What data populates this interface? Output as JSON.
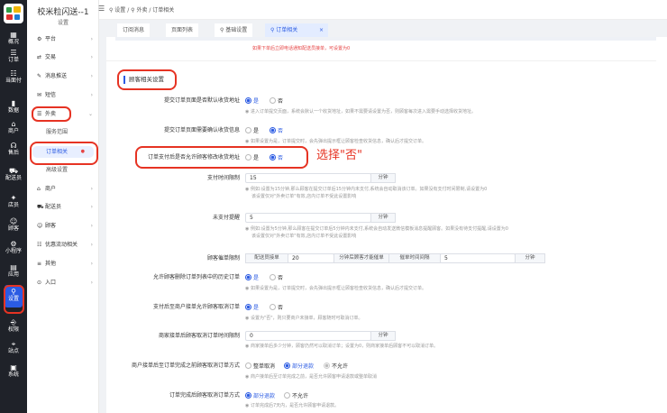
{
  "rail": {
    "items": [
      {
        "icon": "▦",
        "label": "概况"
      },
      {
        "icon": "☰",
        "label": "订单"
      },
      {
        "icon": "☷",
        "label": "当面付"
      },
      {
        "icon": "▮",
        "label": "数据"
      },
      {
        "icon": "⌂",
        "label": "商户"
      },
      {
        "icon": "☊",
        "label": "售后"
      },
      {
        "icon": "⛟",
        "label": "配送员"
      },
      {
        "icon": "✦",
        "label": "店员"
      },
      {
        "icon": "☺",
        "label": "顾客"
      },
      {
        "icon": "⚙",
        "label": "小程序"
      },
      {
        "icon": "▤",
        "label": "应用"
      },
      {
        "icon": "⚲",
        "label": "设置"
      },
      {
        "icon": "⎆",
        "label": "权限"
      },
      {
        "icon": "⌖",
        "label": "站点"
      },
      {
        "icon": "▣",
        "label": "系统"
      }
    ]
  },
  "sidebar": {
    "brand": "校米粒闪送--1",
    "brand_sub": "设置",
    "items": [
      {
        "icon": "⚙",
        "label": "平台"
      },
      {
        "icon": "⇄",
        "label": "交易"
      },
      {
        "icon": "✎",
        "label": "消息推送"
      },
      {
        "icon": "✉",
        "label": "短信"
      },
      {
        "icon": "☰",
        "label": "外卖"
      },
      {
        "icon": "⌂",
        "label": "商户"
      },
      {
        "icon": "⛟",
        "label": "配送员"
      },
      {
        "icon": "☺",
        "label": "顾客"
      },
      {
        "icon": "☷",
        "label": "优惠流动相关"
      },
      {
        "icon": "≡",
        "label": "其他"
      },
      {
        "icon": "⊙",
        "label": "入口"
      }
    ],
    "sub_items": [
      "服务范围",
      "订单相关",
      "高级设置"
    ],
    "chevron_down": "⌄",
    "chevron_right": "›",
    "active_dot": "●"
  },
  "topbar": {
    "menu_icon": "☰",
    "breadcrumb": "⚲ 设置 / ⚲ 外卖 / 订单相关"
  },
  "tabs": [
    {
      "label": "订阅消息"
    },
    {
      "label": "页面列表"
    },
    {
      "label": "⚲ 基础设置"
    },
    {
      "label": "⚲ 订单相关"
    }
  ],
  "tab_close": "×",
  "top_hints": {
    "red_note": "如果下单后立即电话通知配送员接单，可设置为0"
  },
  "section": {
    "title": "顾客相关设置"
  },
  "form": {
    "f1": {
      "label": "提交订单页面是否默认收货地址",
      "yes": "是",
      "no": "否",
      "hint": "进入订单提交页面，系统会默认一个收货地址，如果不需要请设置为否，则顾客每次进入需要手动选择收货地址。"
    },
    "f2": {
      "label": "提交订单页面需要确认收货信息",
      "yes": "是",
      "no": "否",
      "hint": "如果设置为是，订单提交时，会先弹出提示框让顾客检查收货信息，确认后才提交订单。"
    },
    "f3": {
      "label": "订单支付后是否允许顾客修改收货地址",
      "yes": "是",
      "no": "否"
    },
    "f4": {
      "label": "支付时间限制",
      "value": "15",
      "unit": "分钟",
      "hint1": "例如:设置为15分钟,那么顾客在提交订单后15分钟内未支付,系统会自动取消该订单。如果没有支付时间限制,请设置为0",
      "hint2": "该设置仅对\"外卖订单\"有效,店内订单不受此设置影响"
    },
    "f5": {
      "label": "未支付提醒",
      "value": "5",
      "unit": "分钟",
      "hint1": "例如:设置为5分钟,那么顾客在提交订单后5分钟内未支付,系统会自动发送微信模板消息提醒顾客。如果没有待支付提醒,请设置为0",
      "hint2": "该设置仅对\"外卖订单\"有效,店内订单不受此设置影响"
    },
    "f6": {
      "label": "顾客催单限制",
      "addon1": "配送员接单",
      "value1": "20",
      "addon2": "分钟后顾客才能催单",
      "addon3": "催单时间间隔",
      "value2": "5",
      "unit": "分钟"
    },
    "f7": {
      "label": "允许顾客删除订单列表中的历史订单",
      "yes": "是",
      "no": "否",
      "hint": "如果设置为是，订单提交时，会先弹出提示框让顾客检查收货信息，确认后才提交订单。"
    },
    "f8": {
      "label": "支付后至商户接单允许顾客取消订单",
      "yes": "是",
      "no": "否",
      "hint": "设置为\"否\"，则只要商户未接单，顾客随时可取消订单。"
    },
    "f9": {
      "label": "商家接单后顾客取消订单时间限制",
      "value": "0",
      "unit": "分钟",
      "hint": "商家接单后多少分钟，顾客仍然可以取消订单；设置为0，则商家接单后顾客不可以取消订单。"
    },
    "f10": {
      "label": "商户接单后至订单完成之前顾客取消订单方式",
      "opt1": "整单取消",
      "opt2": "部分退款",
      "opt3": "不允许",
      "hint": "商户接单后至订单完成之前，是否允许顾客申请退款或整单取消"
    },
    "f11": {
      "label": "订单完成后顾客取消订单方式",
      "opt1": "部分退款",
      "opt2": "不允许",
      "hint": "订单完成后7天内，是否允许顾客申请退款。"
    }
  },
  "annotation": {
    "callout": "选择\"否\""
  },
  "colors": {
    "primary": "#2b5be3",
    "annotation": "#e63323",
    "rail_bg": "#1f2229"
  }
}
